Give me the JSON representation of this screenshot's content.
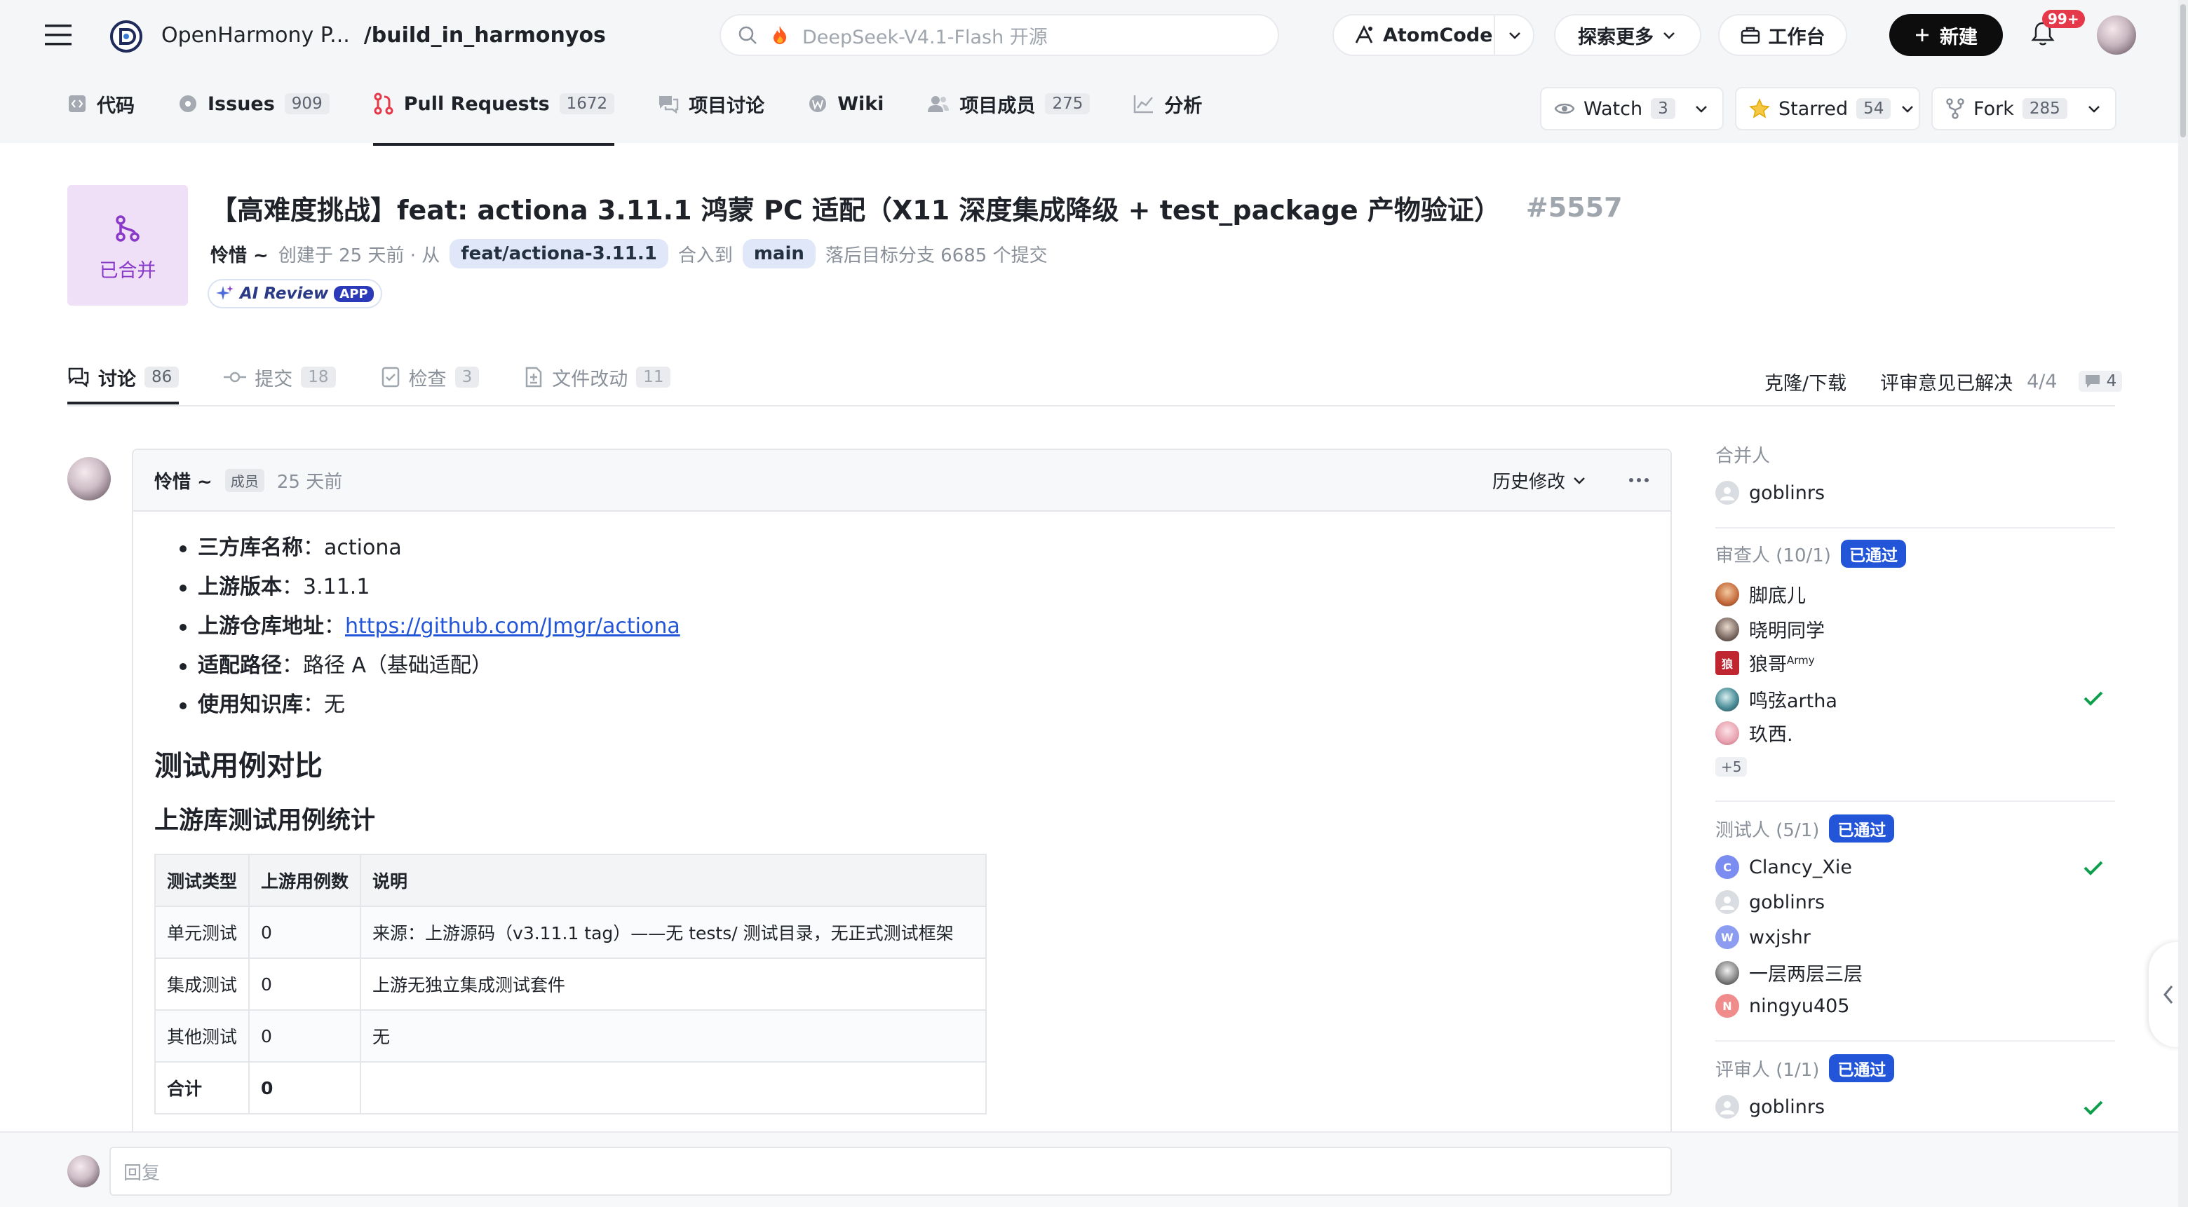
{
  "header": {
    "repo_owner": "OpenHarmony P...",
    "repo_name": "/build_in_harmonyos",
    "search_placeholder": "DeepSeek-V4.1-Flash 开源",
    "atomcode_label": "AtomCode",
    "explore_label": "探索更多",
    "workbench_label": "工作台",
    "new_label": "新建",
    "notif_badge": "99+"
  },
  "repo_tabs": [
    {
      "label": "代码",
      "count": "",
      "icon": "code-icon"
    },
    {
      "label": "Issues",
      "count": "909",
      "icon": "issue-icon"
    },
    {
      "label": "Pull Requests",
      "count": "1672",
      "icon": "pull-request-icon"
    },
    {
      "label": "项目讨论",
      "count": "",
      "icon": "discussion-icon"
    },
    {
      "label": "Wiki",
      "count": "",
      "icon": "wiki-icon"
    },
    {
      "label": "项目成员",
      "count": "275",
      "icon": "members-icon"
    },
    {
      "label": "分析",
      "count": "",
      "icon": "chart-icon"
    }
  ],
  "repo_actions": {
    "watch_label": "Watch",
    "watch_count": "3",
    "starred_label": "Starred",
    "starred_count": "54",
    "fork_label": "Fork",
    "fork_count": "285"
  },
  "pr": {
    "status": "已合并",
    "title": "【高难度挑战】feat: actiona 3.11.1 鸿蒙 PC 适配（X11 深度集成降级 + test_package 产物验证）",
    "number": "#5557",
    "author": "怜惜 ~",
    "created": "创建于 25 天前 · 从",
    "source_branch": "feat/actiona-3.11.1",
    "merge_into": "合入到",
    "target_branch": "main",
    "behind": "落后目标分支 6685 个提交",
    "ai_review": "AI Review",
    "ai_badge": "APP"
  },
  "pr_tabs": [
    {
      "label": "讨论",
      "count": "86",
      "icon": "discussion-icon"
    },
    {
      "label": "提交",
      "count": "18",
      "icon": "commit-icon"
    },
    {
      "label": "检查",
      "count": "3",
      "icon": "check-list-icon"
    },
    {
      "label": "文件改动",
      "count": "11",
      "icon": "file-diff-icon"
    }
  ],
  "pr_tab_right": {
    "clone_label": "克隆/下载",
    "resolved_label": "评审意见已解决",
    "resolved_value": "4/4",
    "comment_count": "4"
  },
  "comment": {
    "author": "怜惜 ~",
    "role": "成员",
    "time": "25 天前",
    "history_label": "历史修改",
    "info": [
      {
        "key": "三方库名称",
        "sep": "：",
        "value": "actiona"
      },
      {
        "key": "上游版本",
        "sep": "：",
        "value": "3.11.1"
      },
      {
        "key": "上游仓库地址",
        "sep": "：",
        "value": "https://github.com/Jmgr/actiona"
      },
      {
        "key": "适配路径",
        "sep": "：",
        "value": "路径 A（基础适配）"
      },
      {
        "key": "使用知识库",
        "sep": "：",
        "value": "无"
      }
    ],
    "h2": "测试用例对比",
    "h3": "上游库测试用例统计",
    "table_headers": [
      "测试类型",
      "上游用例数",
      "说明"
    ],
    "table_rows": [
      [
        "单元测试",
        "0",
        "来源：上游源码（v3.11.1 tag）——无 tests/ 测试目录，无正式测试框架"
      ],
      [
        "集成测试",
        "0",
        "上游无独立集成测试套件"
      ],
      [
        "其他测试",
        "0",
        "无"
      ],
      [
        "合计",
        "0",
        ""
      ]
    ]
  },
  "sidebar": {
    "merger_title": "合并人",
    "merger": "goblinrs",
    "reviewers_title": "审查人 (10/1)",
    "reviewers_status": "已通过",
    "reviewers": [
      "脚底儿",
      "晓明同学",
      "狼哥",
      "鸣弦artha",
      "玖西."
    ],
    "reviewer_sup": "Army",
    "reviewers_more": "+5",
    "testers_title": "测试人 (5/1)",
    "testers_status": "已通过",
    "testers": [
      "Clancy_Xie",
      "goblinrs",
      "wxjshr",
      "一层两层三层",
      "ningyu405"
    ],
    "tester_initials": [
      "C",
      "",
      "W",
      "",
      "N"
    ],
    "approvers_title": "评审人 (1/1)",
    "approvers_status": "已通过",
    "approvers": [
      "goblinrs"
    ]
  },
  "reply": {
    "placeholder": "回复"
  },
  "colors": {
    "accent_red": "#e5384a",
    "merged_purple": "#8a39c9",
    "approved_blue": "#2355d8",
    "check_green": "#0e9f4d",
    "link_blue": "#2355d8"
  }
}
